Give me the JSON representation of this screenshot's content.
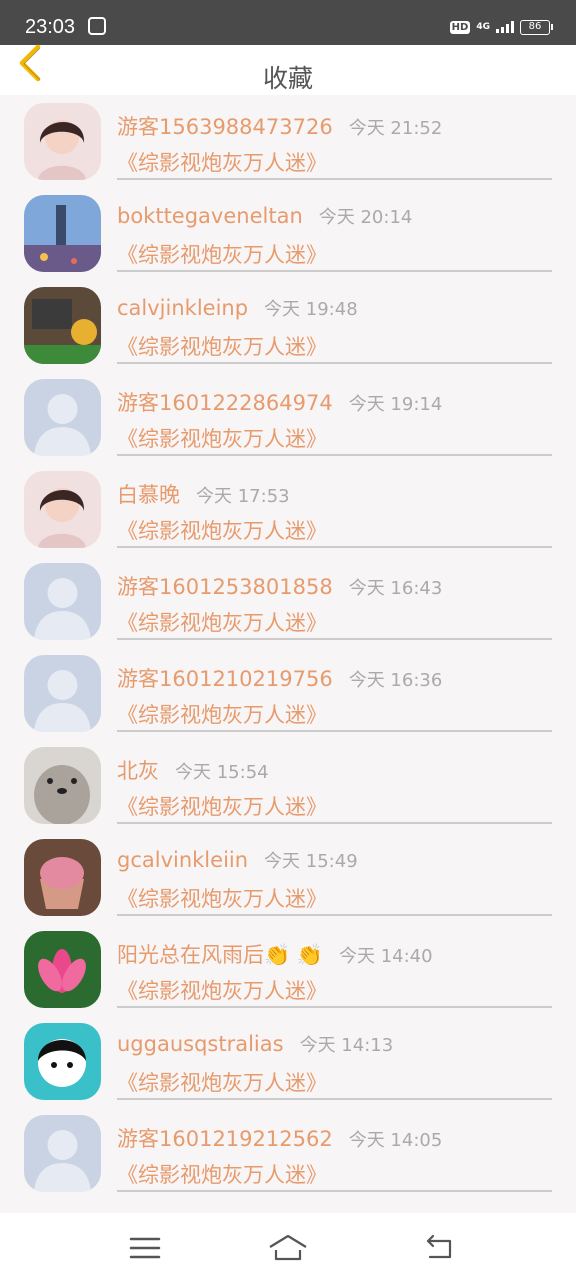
{
  "status": {
    "time": "23:03",
    "hd": "HD",
    "network": "4G",
    "battery": "86"
  },
  "header": {
    "title": "收藏"
  },
  "items": [
    {
      "name": "游客1563988473726",
      "time": "今天 21:52",
      "book": "《综影视炮灰万人迷》",
      "avatar": "girl-portrait"
    },
    {
      "name": "bokttegaveneltan",
      "time": "今天 20:14",
      "book": "《综影视炮灰万人迷》",
      "avatar": "city-night"
    },
    {
      "name": "calvjinkleinp",
      "time": "今天 19:48",
      "book": "《综影视炮灰万人迷》",
      "avatar": "cartoon"
    },
    {
      "name": "游客1601222864974",
      "time": "今天 19:14",
      "book": "《综影视炮灰万人迷》",
      "avatar": "default-user"
    },
    {
      "name": "白慕晚",
      "time": "今天 17:53",
      "book": "《综影视炮灰万人迷》",
      "avatar": "girl-portrait"
    },
    {
      "name": "游客1601253801858",
      "time": "今天 16:43",
      "book": "《综影视炮灰万人迷》",
      "avatar": "default-user"
    },
    {
      "name": "游客1601210219756",
      "time": "今天 16:36",
      "book": "《综影视炮灰万人迷》",
      "avatar": "default-user"
    },
    {
      "name": "北灰",
      "time": "今天 15:54",
      "book": "《综影视炮灰万人迷》",
      "avatar": "bear-cartoon"
    },
    {
      "name": "gcalvinkleiin",
      "time": "今天 15:49",
      "book": "《综影视炮灰万人迷》",
      "avatar": "cupcake"
    },
    {
      "name": "阳光总在风雨后👏 👏",
      "time": "今天 14:40",
      "book": "《综影视炮灰万人迷》",
      "avatar": "lotus"
    },
    {
      "name": "uggausqstralias",
      "time": "今天 14:13",
      "book": "《综影视炮灰万人迷》",
      "avatar": "cartoon-girl"
    },
    {
      "name": "游客1601219212562",
      "time": "今天 14:05",
      "book": "《综影视炮灰万人迷》",
      "avatar": "default-user"
    }
  ],
  "colors": {
    "accent": "#e79b6d",
    "time": "#aaaaaa",
    "divider": "#cccccc",
    "statusbar": "#4a4a4a"
  },
  "nav": {
    "icons": [
      "menu-icon",
      "home-icon",
      "back-icon"
    ]
  }
}
